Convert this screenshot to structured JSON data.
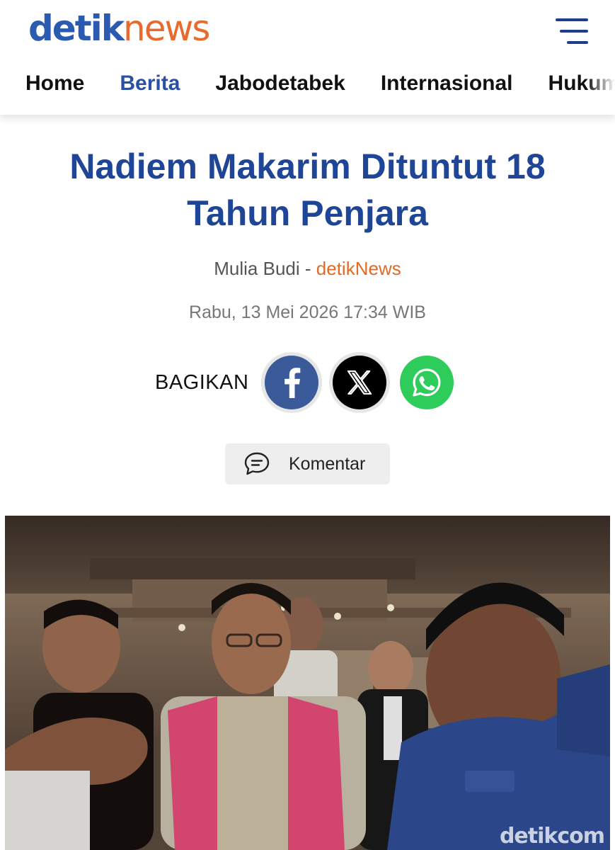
{
  "header": {
    "logo": {
      "part1": "detik",
      "part2": "news"
    },
    "menu_icon": "hamburger-menu-icon",
    "nav": [
      "Home",
      "Berita",
      "Jabodetabek",
      "Internasional",
      "Hukum"
    ],
    "active_nav": "Berita"
  },
  "article": {
    "title": "Nadiem Makarim Dituntut 18 Tahun Penjara",
    "author": "Mulia Budi",
    "separator": " - ",
    "source": "detikNews",
    "date": "Rabu, 13 Mei 2026 17:34 WIB"
  },
  "share": {
    "label": "BAGIKAN",
    "buttons": [
      "facebook-icon",
      "x-icon",
      "whatsapp-icon"
    ]
  },
  "comment": {
    "label": "Komentar",
    "icon": "comment-bubble-icon"
  },
  "photo": {
    "watermark": "detikcom"
  },
  "colors": {
    "brand_blue": "#2a5bb0",
    "brand_orange": "#e86a2c",
    "title_blue": "#1f4596",
    "facebook": "#3b5a9a",
    "whatsapp": "#2ecc5a"
  }
}
